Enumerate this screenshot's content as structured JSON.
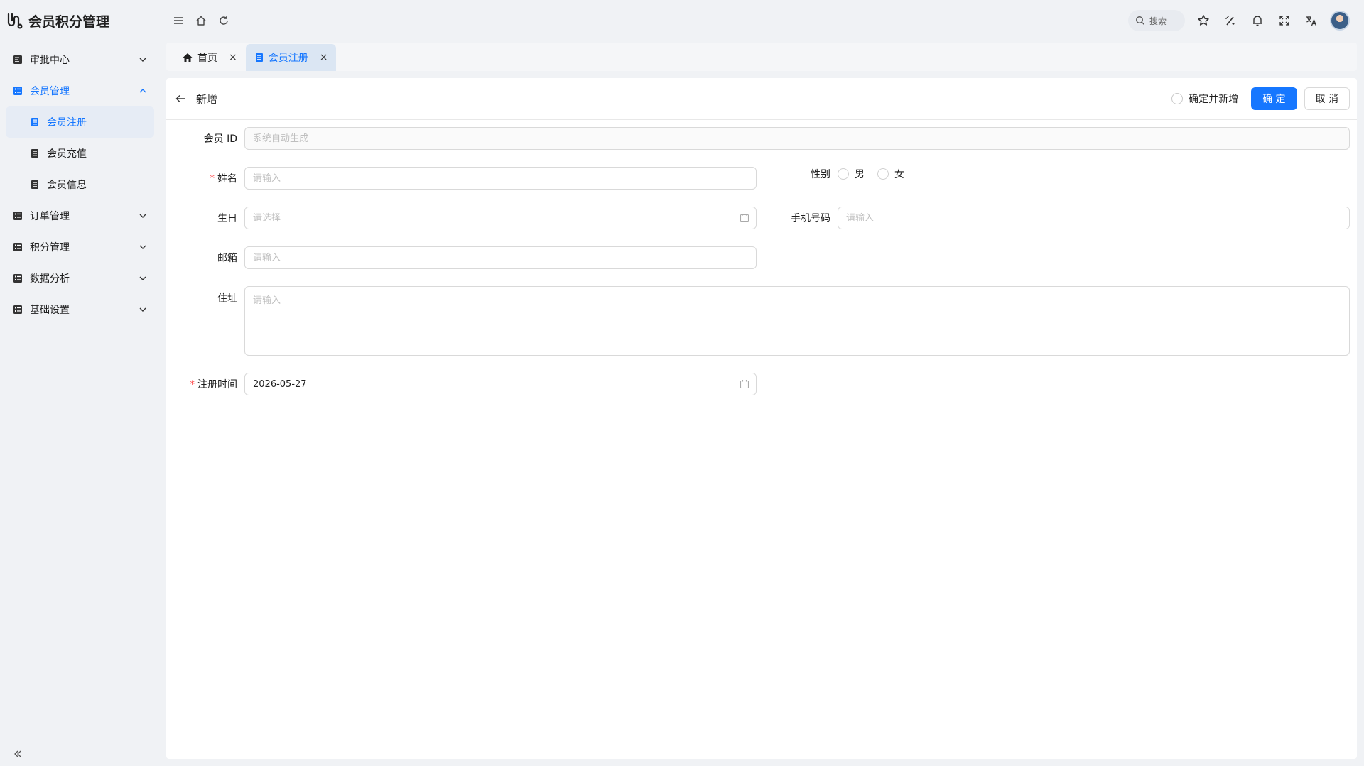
{
  "app": {
    "title": "会员积分管理"
  },
  "sidebar": {
    "items": [
      {
        "label": "审批中心",
        "expanded": false
      },
      {
        "label": "会员管理",
        "expanded": true,
        "children": [
          {
            "label": "会员注册",
            "active": true
          },
          {
            "label": "会员充值",
            "active": false
          },
          {
            "label": "会员信息",
            "active": false
          }
        ]
      },
      {
        "label": "订单管理",
        "expanded": false
      },
      {
        "label": "积分管理",
        "expanded": false
      },
      {
        "label": "数据分析",
        "expanded": false
      },
      {
        "label": "基础设置",
        "expanded": false
      }
    ]
  },
  "header": {
    "search_label": "搜索"
  },
  "tabs": [
    {
      "label": "首页",
      "active": false
    },
    {
      "label": "会员注册",
      "active": true
    }
  ],
  "page": {
    "title": "新增",
    "confirm_and_add_label": "确定并新增",
    "confirm_label": "确 定",
    "cancel_label": "取 消"
  },
  "form": {
    "member_id": {
      "label": "会员 ID",
      "placeholder": "系统自动生成",
      "value": ""
    },
    "name": {
      "label": "姓名",
      "required": true,
      "placeholder": "请输入",
      "value": ""
    },
    "gender": {
      "label": "性别",
      "options": [
        "男",
        "女"
      ],
      "selected": null
    },
    "birthday": {
      "label": "生日",
      "placeholder": "请选择",
      "value": ""
    },
    "phone": {
      "label": "手机号码",
      "placeholder": "请输入",
      "value": ""
    },
    "email": {
      "label": "邮箱",
      "placeholder": "请输入",
      "value": ""
    },
    "address": {
      "label": "住址",
      "placeholder": "请输入",
      "value": ""
    },
    "register_time": {
      "label": "注册时间",
      "required": true,
      "placeholder": "",
      "value": "2026-05-27"
    }
  },
  "colors": {
    "primary": "#1677ff",
    "required": "#ff4d4f",
    "background": "#f0f2f5"
  }
}
